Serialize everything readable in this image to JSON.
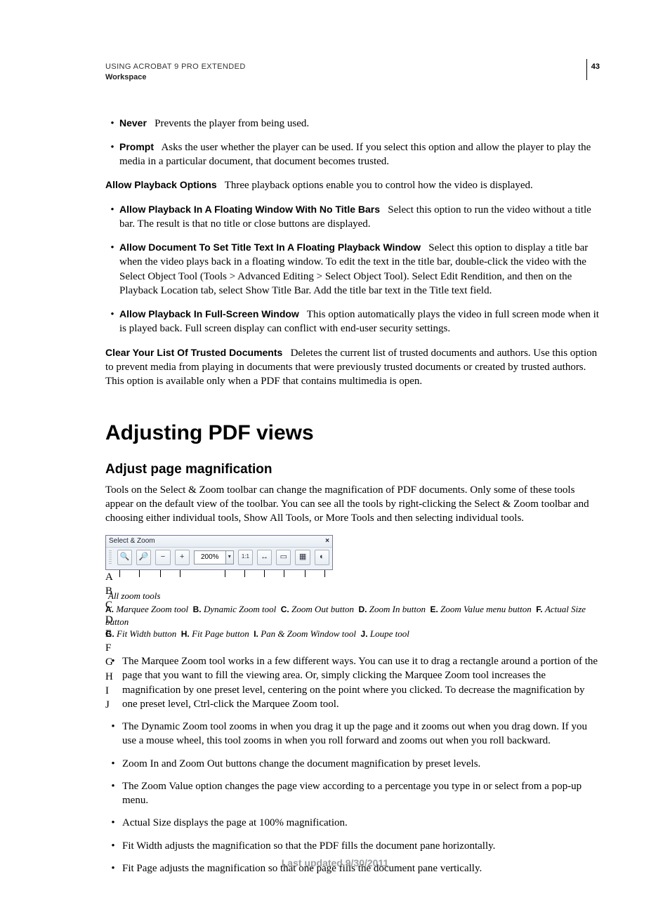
{
  "header": {
    "title": "USING ACROBAT 9 PRO EXTENDED",
    "subtitle": "Workspace",
    "page_number": "43"
  },
  "sec1": {
    "never_label": "Never",
    "never_text": "Prevents the player from being used.",
    "prompt_label": "Prompt",
    "prompt_text": "Asks the user whether the player can be used. If you select this option and allow the player to play the media in a particular document, that document becomes trusted.",
    "apo_label": "Allow Playback Options",
    "apo_text": "Three playback options enable you to control how the video is displayed.",
    "float_label": "Allow Playback In A Floating Window With No Title Bars",
    "float_text": "Select this option to run the video without a title bar. The result is that no title or close buttons are displayed.",
    "titletext_label": "Allow Document To Set Title Text In A Floating Playback Window",
    "titletext_text": "Select this option to display a title bar when the video plays back in a floating window. To edit the text in the title bar, double-click the video with the Select Object Tool (Tools > Advanced Editing > Select Object Tool). Select Edit Rendition, and then on the Playback Location tab, select Show Title Bar. Add the title bar text in the Title text field.",
    "full_label": "Allow Playback In Full-Screen Window",
    "full_text": "This option automatically plays the video in full screen mode when it is played back. Full screen display can conflict with end-user security settings.",
    "clear_label": "Clear Your List Of Trusted Documents",
    "clear_text": "Deletes the current list of trusted documents and authors. Use this option to prevent media from playing in documents that were previously trusted documents or created by trusted authors. This option is available only when a PDF that contains multimedia is open."
  },
  "sec2": {
    "h1": "Adjusting PDF views",
    "h2": "Adjust page magnification",
    "intro": "Tools on the Select & Zoom toolbar can change the magnification of PDF documents. Only some of these tools appear on the default view of the toolbar. You can see all the tools by right-clicking the Select & Zoom toolbar and choosing either individual tools, Show All Tools, or More Tools and then selecting individual tools."
  },
  "toolbar": {
    "title": "Select & Zoom",
    "zoom_value": "200%",
    "labels": [
      "A",
      "B",
      "C",
      "D",
      "E",
      "F",
      "G",
      "H",
      "I",
      "J"
    ]
  },
  "fig": {
    "caption": "All zoom tools",
    "legend": {
      "A": "Marquee Zoom tool",
      "B": "Dynamic Zoom tool",
      "C": "Zoom Out button",
      "D": "Zoom In button",
      "E": "Zoom Value menu button",
      "F": "Actual Size button",
      "G": "Fit Width button",
      "H": "Fit Page button",
      "I": "Pan & Zoom Window tool",
      "J": "Loupe tool"
    }
  },
  "bullets2": {
    "b1": "The Marquee Zoom tool works in a few different ways. You can use it to drag a rectangle around a portion of the page that you want to fill the viewing area. Or, simply clicking the Marquee Zoom tool increases the magnification by one preset level, centering on the point where you clicked. To decrease the magnification by one preset level, Ctrl-click the Marquee Zoom tool.",
    "b2": "The Dynamic Zoom tool zooms in when you drag it up the page and it zooms out when you drag down. If you use a mouse wheel, this tool zooms in when you roll forward and zooms out when you roll backward.",
    "b3": " Zoom In and Zoom Out buttons change the document magnification by preset levels.",
    "b4": "The Zoom Value option changes the page view according to a percentage you type in or select from a pop-up menu.",
    "b5": "Actual Size displays the page at 100% magnification.",
    "b6": "Fit Width adjusts the magnification so that the PDF fills the document pane horizontally.",
    "b7": "Fit Page adjusts the magnification so that one page fills the document pane vertically."
  },
  "footer": "Last updated 9/30/2011"
}
